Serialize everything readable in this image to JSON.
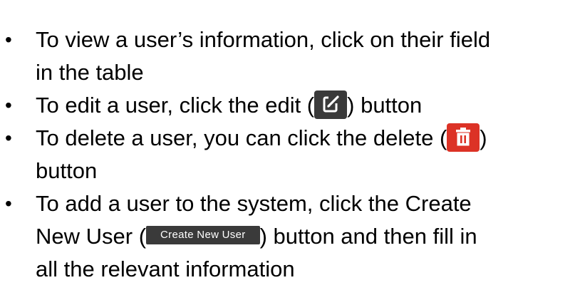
{
  "bullets": [
    {
      "line1": "To view a user’s information, click on their field",
      "line2": "in the table"
    },
    {
      "before": "To edit a user, click the edit (",
      "after": ") button",
      "icon": "edit-icon"
    },
    {
      "before": "To delete a user, you can click the delete (",
      "after": ")",
      "line2": "button",
      "icon": "trash-icon"
    },
    {
      "line1": "To add a user to the system, click the Create",
      "before": "New User (",
      "button_label": "Create New User",
      "after": ") button and then fill in",
      "line3": "all the relevant information"
    }
  ],
  "colors": {
    "edit_button": "#3a3a3a",
    "delete_button": "#dc3226",
    "create_button": "#3a3a3a",
    "text": "#000000"
  }
}
